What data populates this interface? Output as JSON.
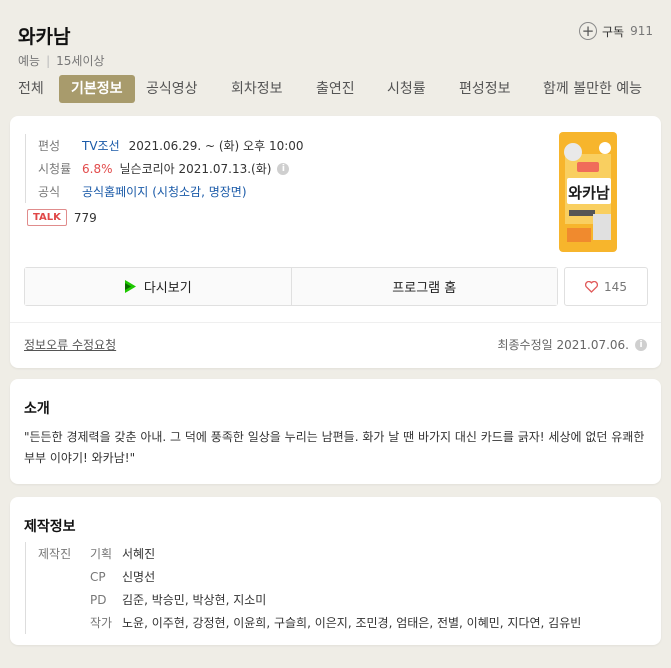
{
  "header": {
    "title": "와카남",
    "genre": "예능",
    "rating": "15세이상",
    "subscribe_label": "구독",
    "subscribe_count": "911"
  },
  "tabs": [
    {
      "label": "전체",
      "active": false
    },
    {
      "label": "기본정보",
      "active": true
    },
    {
      "label": "공식영상",
      "active": false
    },
    {
      "label": "회차정보",
      "active": false
    },
    {
      "label": "출연진",
      "active": false
    },
    {
      "label": "시청률",
      "active": false
    },
    {
      "label": "편성정보",
      "active": false
    },
    {
      "label": "함께 볼만한 예능",
      "active": false
    }
  ],
  "info": {
    "schedule_label": "편성",
    "channel": "TV조선",
    "schedule": "2021.06.29. ~ (화) 오후 10:00",
    "ratings_label": "시청률",
    "ratings_value": "6.8%",
    "ratings_source": "닐슨코리아 2021.07.13.(화)",
    "official_label": "공식",
    "official_link": "공식홈페이지",
    "official_extra": "(시청소감, 명장면)",
    "talk_badge": "TALK",
    "talk_count": "779",
    "poster_text": "와카남"
  },
  "buttons": {
    "rewatch": "다시보기",
    "program_home": "프로그램 홈",
    "like_count": "145"
  },
  "footer": {
    "report_link": "정보오류 수정요청",
    "updated": "최종수정일 2021.07.06."
  },
  "intro": {
    "title": "소개",
    "text": "\"든든한 경제력을 갖춘 아내. 그 덕에 풍족한 일상을 누리는 남편들. 화가 날 땐 바가지 대신 카드를 긁자! 세상에 없던 유쾌한 부부 이야기! 와카남!\""
  },
  "production": {
    "title": "제작정보",
    "category": "제작진",
    "rows": [
      {
        "role": "기획",
        "names": "서혜진",
        "link": true
      },
      {
        "role": "CP",
        "names": "신명선",
        "link": false
      },
      {
        "role": "PD",
        "names": "김준, 박승민, 박상현, 지소미",
        "link": false
      },
      {
        "role": "작가",
        "names": "노윤, 이주현, 강정현, 이윤희, 구슬희, 이은지, 조민경, 엄태은, 전별, 이혜민, 지다연, 김유빈",
        "link": false
      }
    ]
  },
  "colors": {
    "accent_tab": "#a89b6c",
    "link": "#1a5aa8",
    "rating_red": "#e24b4b",
    "background": "#efede6"
  }
}
